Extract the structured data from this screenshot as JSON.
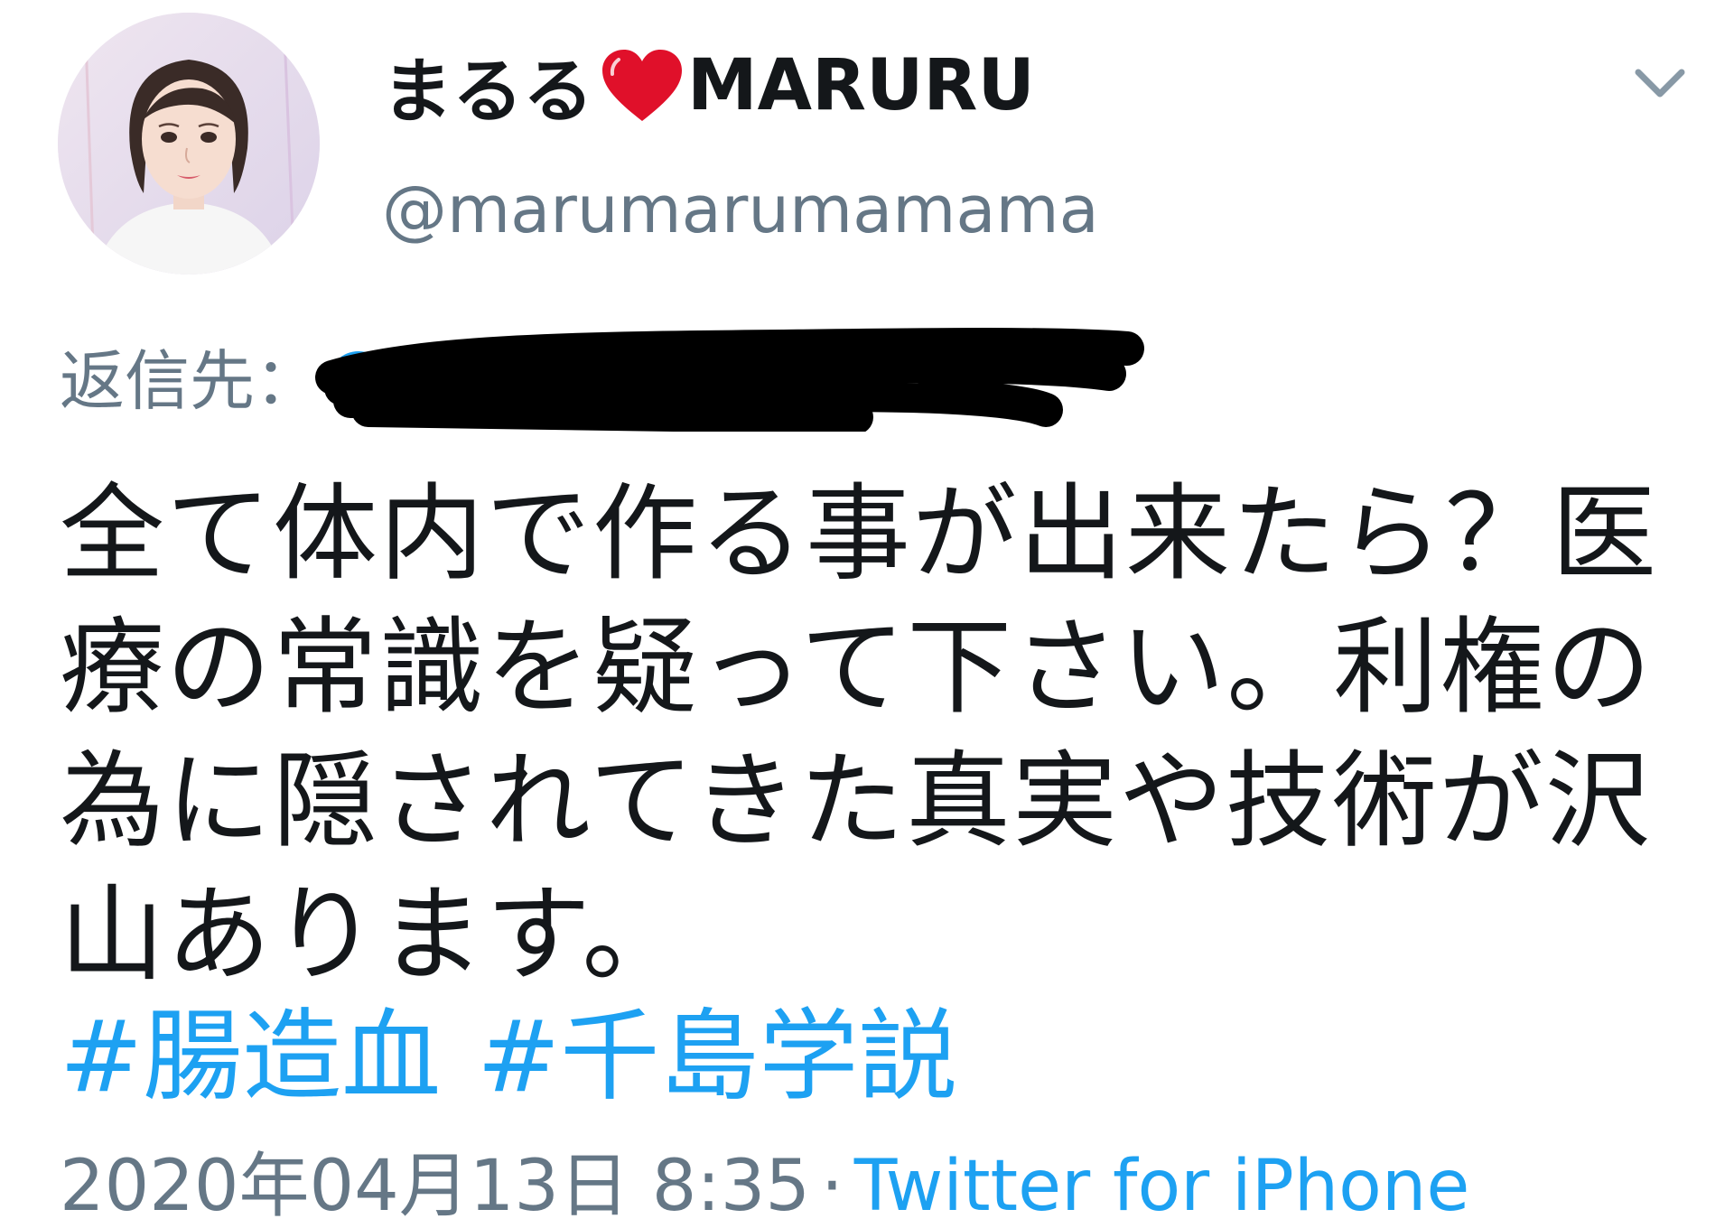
{
  "author": {
    "display_name_prefix": "まるる",
    "display_name_suffix": "MARURU",
    "handle": "@marumarumamama",
    "avatar_icon": "avatar-portrait"
  },
  "reply": {
    "label": "返信先：",
    "target_visible": "@a",
    "redacted": true
  },
  "tweet": {
    "text": "全て体内で作る事が出来たら？医療の常識を疑って下さい。利権の為に隠されてきた真実や技術が沢山あります。",
    "hashtags": [
      "#腸造血",
      "#千島学説"
    ]
  },
  "meta": {
    "timestamp": "2020年04月13日 8:35",
    "separator": "·",
    "source": "Twitter for iPhone"
  },
  "icons": {
    "heart": "red-heart-emoji",
    "caret": "chevron-down-icon"
  },
  "colors": {
    "text": "#14171a",
    "secondary": "#657786",
    "link": "#1da1f2",
    "heart": "#e0102a"
  }
}
